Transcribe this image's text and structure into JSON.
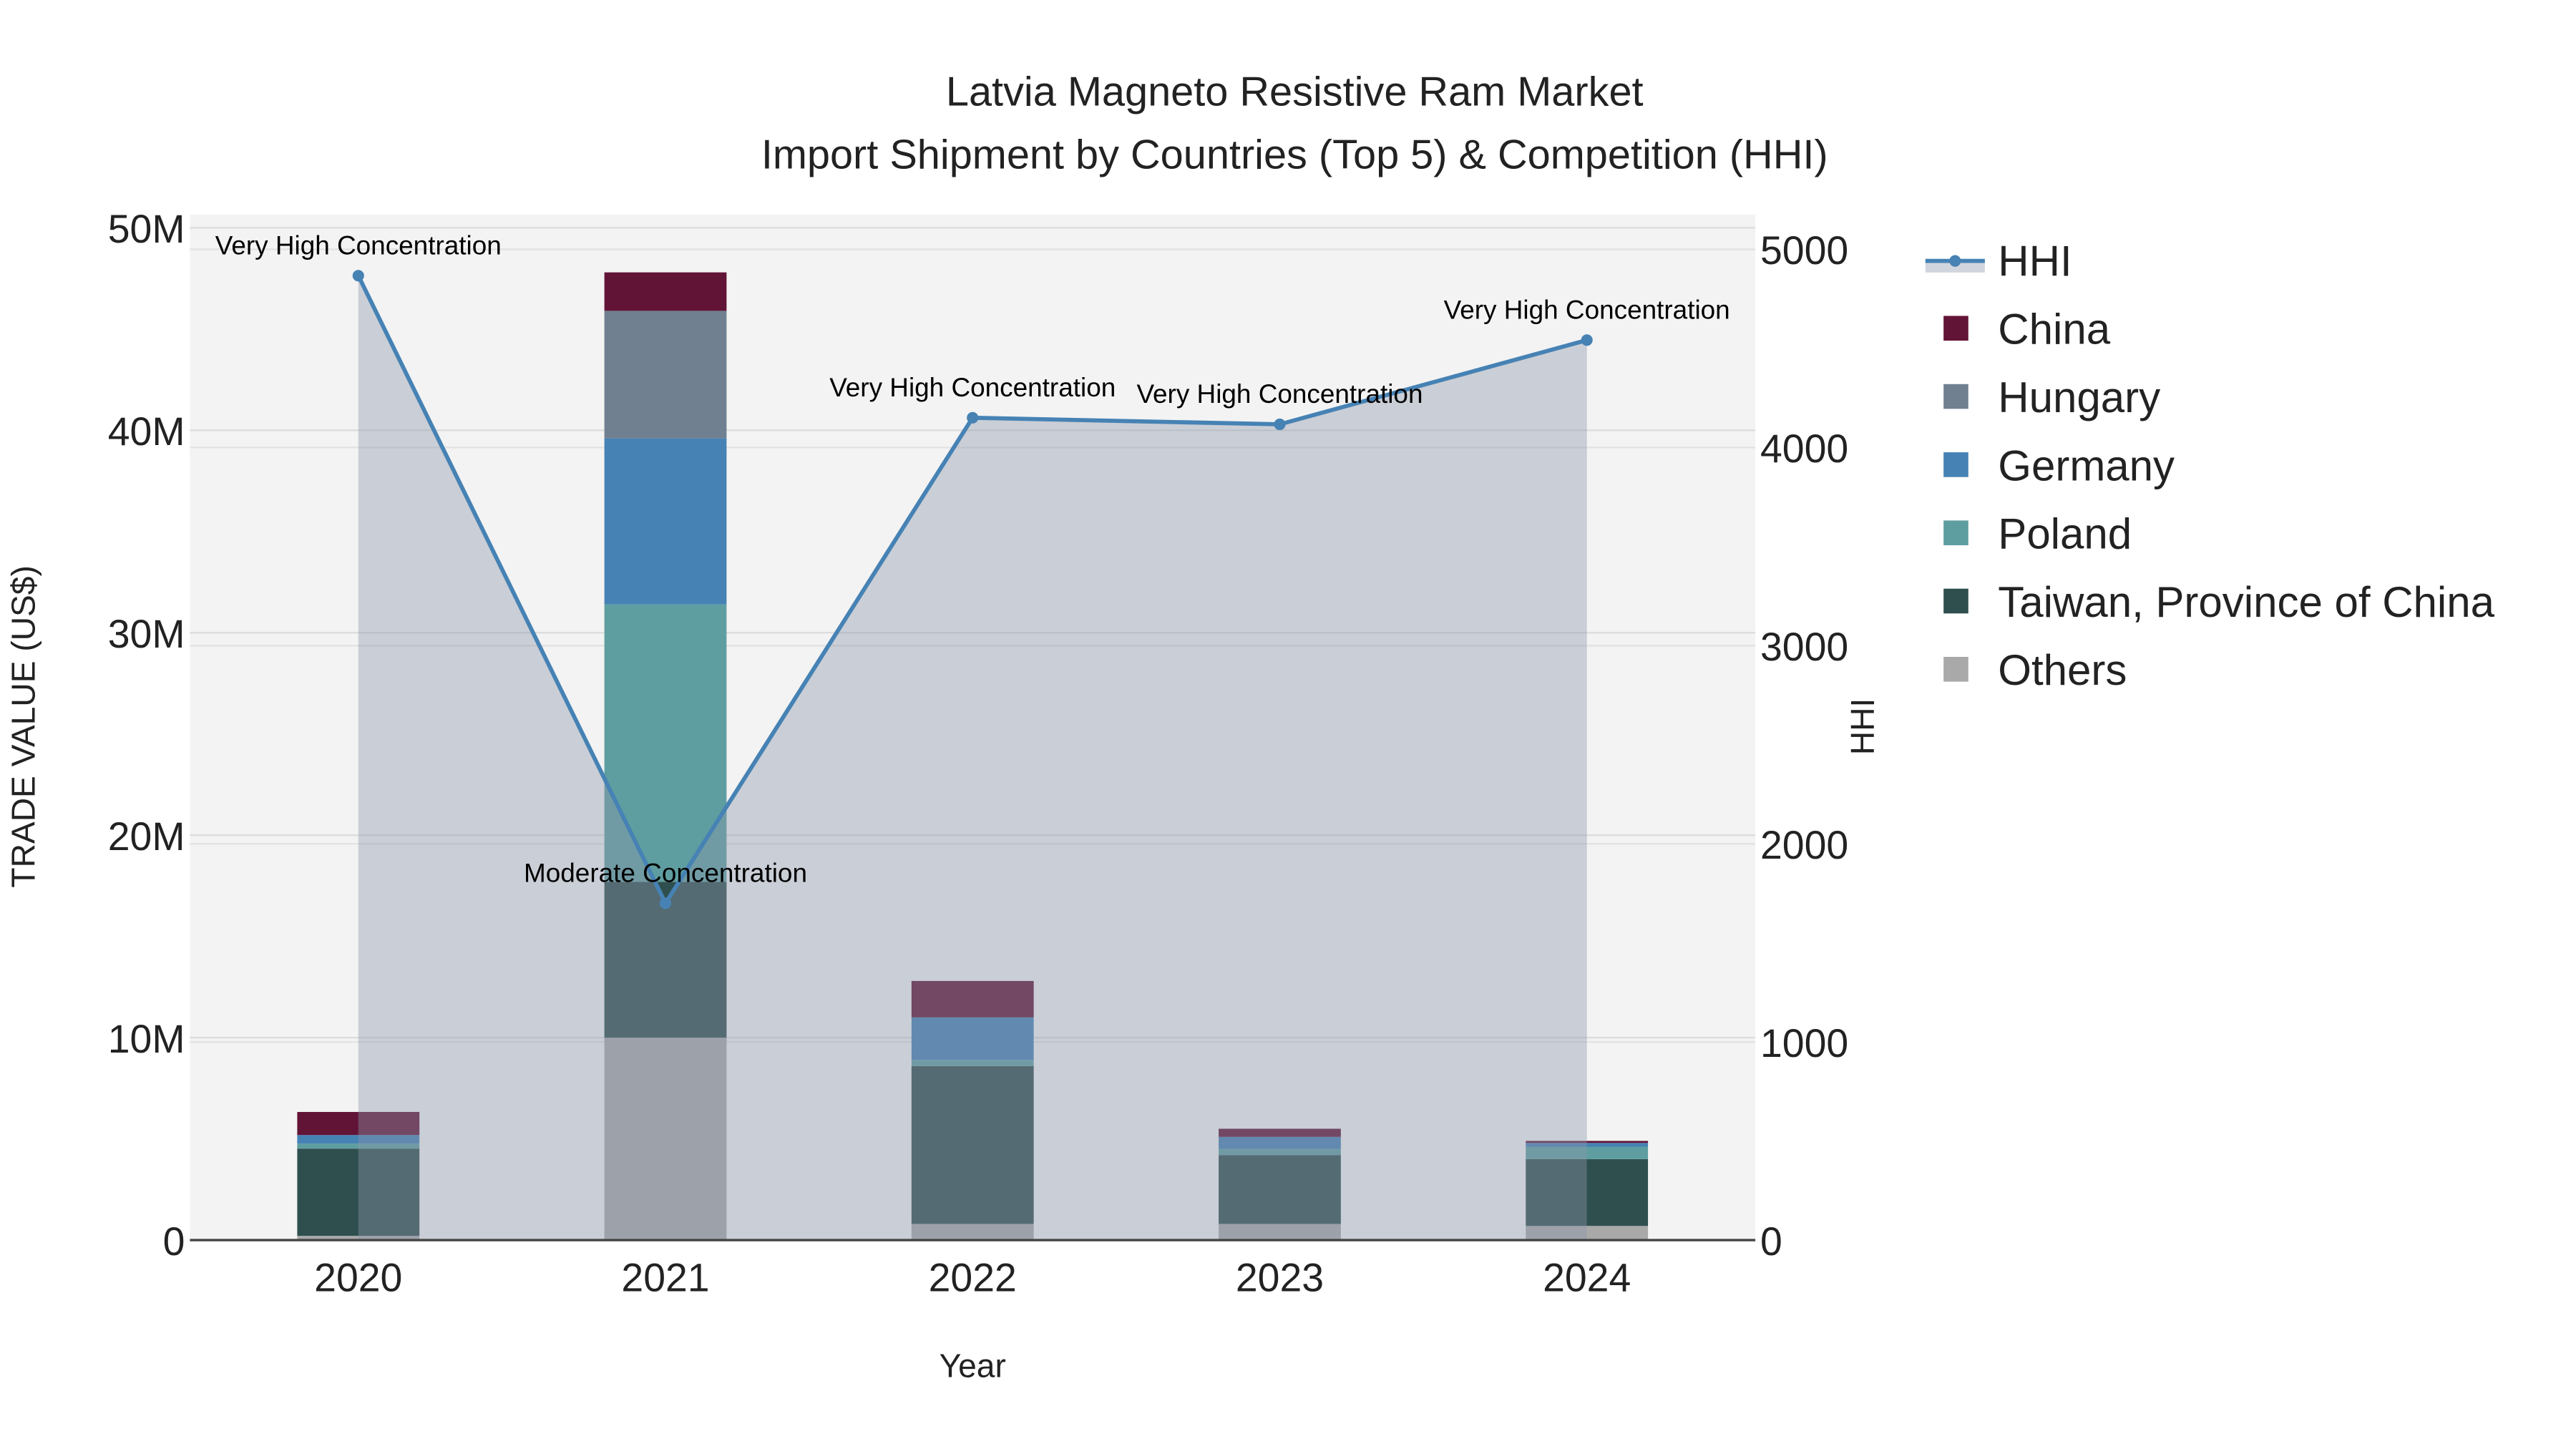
{
  "chart_data": {
    "type": "bar",
    "title": "Latvia Magneto Resistive Ram Market",
    "subtitle": "Import Shipment by Countries (Top 5) & Competition (HHI)",
    "xlabel": "Year",
    "ylabel": "TRADE VALUE (US$)",
    "y2label": "HHI",
    "categories": [
      "2020",
      "2021",
      "2022",
      "2023",
      "2024"
    ],
    "ylim": [
      0,
      50650000
    ],
    "y2lim": [
      0,
      5175
    ],
    "yticks": [
      {
        "v": 0,
        "label": "0"
      },
      {
        "v": 10000000,
        "label": "10M"
      },
      {
        "v": 20000000,
        "label": "20M"
      },
      {
        "v": 30000000,
        "label": "30M"
      },
      {
        "v": 40000000,
        "label": "40M"
      },
      {
        "v": 50000000,
        "label": "50M"
      }
    ],
    "y2ticks": [
      {
        "v": 0,
        "label": "0"
      },
      {
        "v": 1000,
        "label": "1000"
      },
      {
        "v": 2000,
        "label": "2000"
      },
      {
        "v": 3000,
        "label": "3000"
      },
      {
        "v": 4000,
        "label": "4000"
      },
      {
        "v": 5000,
        "label": "5000"
      }
    ],
    "stacked": true,
    "series": [
      {
        "name": "Others",
        "color": "#a9a9a9",
        "values": [
          210000,
          10000000,
          800000,
          800000,
          700000
        ]
      },
      {
        "name": "Taiwan, Province of China",
        "color": "#2f4f4f",
        "values": [
          4310000,
          7700000,
          7800000,
          3400000,
          3300000
        ]
      },
      {
        "name": "Poland",
        "color": "#5f9ea0",
        "values": [
          250000,
          13700000,
          300000,
          300000,
          600000
        ]
      },
      {
        "name": "Germany",
        "color": "#4682b4",
        "values": [
          420000,
          8200000,
          2100000,
          600000,
          200000
        ]
      },
      {
        "name": "Hungary",
        "color": "#708090",
        "values": [
          0,
          6300000,
          0,
          0,
          0
        ]
      },
      {
        "name": "China",
        "color": "#621436",
        "values": [
          1140000,
          1900000,
          1800000,
          400000,
          100000
        ]
      }
    ],
    "line": {
      "name": "HHI",
      "color": "#4682b4",
      "values": [
        4867,
        1700,
        4150,
        4117,
        4542
      ],
      "annotations": [
        "Very High Concentration",
        "Moderate Concentration",
        "Very High Concentration",
        "Very High Concentration",
        "Very High Concentration"
      ]
    },
    "legend": {
      "placement": "right",
      "order": [
        "HHI",
        "China",
        "Hungary",
        "Germany",
        "Poland",
        "Taiwan, Province of China",
        "Others"
      ]
    },
    "grid": true
  }
}
